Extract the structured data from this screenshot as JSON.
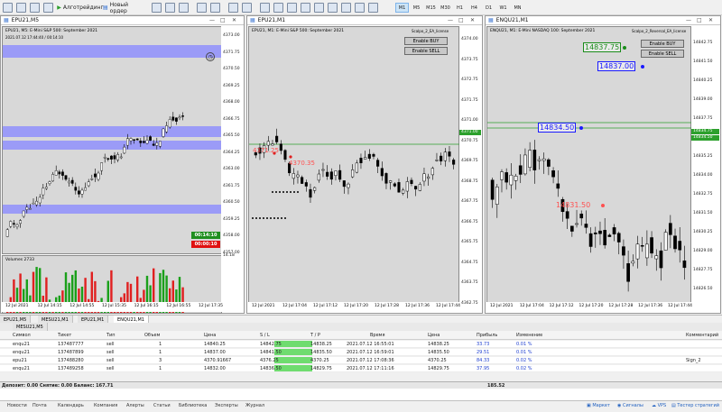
{
  "toolbar": {
    "algo_label": "Алготрейдинг",
    "new_order_label": "Новый ордер",
    "timeframes": [
      "M1",
      "M5",
      "M15",
      "M30",
      "H1",
      "H4",
      "D1",
      "W1",
      "MN"
    ],
    "active_timeframe": "M1"
  },
  "windows": [
    {
      "tab": "EPU21,M5",
      "chart_title": "EPU21, M5: E-Mini S&P 500: September 2021",
      "sub_info": "2021.07.12 17:44:40 / 00:14:10",
      "timer_green": "00:14:10",
      "timer_red": "00:00:10",
      "volume_label": "Volumes 2733",
      "prices": [
        "4373.00",
        "4371.75",
        "4370.50",
        "4369.25",
        "4368.00",
        "4366.75",
        "4365.50",
        "4364.25",
        "4363.00",
        "4361.75",
        "4360.50",
        "4359.25",
        "4358.00",
        "4357.00"
      ],
      "vol_scale": [
        "2733",
        "14.18"
      ],
      "times": [
        "12 Jul 2021",
        "12 Jul 14:15",
        "12 Jul 14:55",
        "12 Jul 15:35",
        "12 Jul 16:15",
        "12 Jul 16:55",
        "12 Jul 17:35"
      ]
    },
    {
      "tab": "EPU21,M1",
      "chart_title": "EPU21, M1: E-Mini S&P 500: September 2021",
      "ea_label": "Scalpo_2_EA_license",
      "buy_label": "Enable BUY",
      "sell_label": "Enable SELL",
      "levels": [
        "4371.25",
        "4370.35"
      ],
      "current_price": "4371.00",
      "prices": [
        "4374.00",
        "4373.75",
        "4372.75",
        "4371.75",
        "4371.00",
        "4370.75",
        "4369.75",
        "4368.75",
        "4367.75",
        "4366.75",
        "4365.75",
        "4364.75",
        "4363.75",
        "4362.75"
      ],
      "times": [
        "12 Jul 2021",
        "12 Jul 17:04",
        "12 Jul 17:12",
        "12 Jul 17:20",
        "12 Jul 17:28",
        "12 Jul 17:36",
        "12 Jul 17:44"
      ]
    },
    {
      "tab": "ENQU21,M1",
      "chart_title": "ENQU21, M1: E-Mini NASDAQ 100: September 2021",
      "ea_label": "Scalpo_2_Reversal_EA_license",
      "buy_label": "Enable BUY",
      "sell_label": "Enable SELL",
      "labels": {
        "top": "14837.75",
        "high": "14837.00",
        "mid": "14834.50",
        "low": "14831.50"
      },
      "price_tags": [
        "14834.75",
        "14834.50"
      ],
      "prices": [
        "14842.75",
        "14841.50",
        "14840.25",
        "14839.00",
        "14837.75",
        "14836.50",
        "14835.25",
        "14834.00",
        "14832.75",
        "14831.50",
        "14830.25",
        "14829.00",
        "14827.75",
        "14826.50"
      ],
      "times": [
        "12 Jul 2021",
        "12 Jul 17:04",
        "12 Jul 17:12",
        "12 Jul 17:20",
        "12 Jul 17:28",
        "12 Jul 17:36",
        "12 Jul 17:44"
      ]
    }
  ],
  "chart_tabs": [
    "EPU21,M5",
    "MESU21,M1",
    "EPU21,M1",
    "ENQU21,M1"
  ],
  "bottom_chart_tab": "MESU21,M5",
  "trade": {
    "headers": [
      "Символ",
      "Тикет",
      "Тип",
      "Объем",
      "Цена",
      "S / L",
      "T / P",
      "Время",
      "Цена",
      "Прибыль",
      "Изменение",
      "Комментарий"
    ],
    "rows": [
      [
        "enqu21",
        "137487777",
        "sell",
        "1",
        "14840.25",
        "14842.75",
        "14838.25",
        "2021.07.12 16:55:01",
        "14838.25",
        "33.73",
        "0.01 %",
        ""
      ],
      [
        "enqu21",
        "137487899",
        "sell",
        "1",
        "14837.00",
        "14841.50",
        "14835.50",
        "2021.07.12 16:59:01",
        "14835.50",
        "29.51",
        "0.01 %",
        ""
      ],
      [
        "epu21",
        "137488280",
        "sell",
        "3",
        "4370.91667",
        "4376.25",
        "4370.25",
        "2021.07.12 17:08:36",
        "4370.25",
        "84.33",
        "0.02 %",
        "Sign_2"
      ],
      [
        "enqu21",
        "137489258",
        "sell",
        "1",
        "14832.00",
        "14836.50",
        "14829.75",
        "2021.07.12 17:11:16",
        "14829.75",
        "37.95",
        "0.02 %",
        ""
      ]
    ],
    "balance_text": "Депозит: 0.00  Снятие: 0.00  Баланс: 167.71",
    "total_profit": "185.52"
  },
  "bottom_tabs": [
    "Новости",
    "Почта",
    "Календарь",
    "Компания",
    "Алерты",
    "Статьи",
    "Библиотека",
    "Эксперты",
    "Журнал"
  ],
  "bottom_right": [
    "Маркет",
    "Сигналы",
    "VPS",
    "Тестер стратегий"
  ],
  "colors": {
    "chart_bg": "#d8d8d8",
    "up": "#ffffff",
    "down": "#000000",
    "zone": "#8c8cff",
    "level": "#2ca02c",
    "sell_tp": "#7ff07f",
    "red_label": "#ff5050",
    "blue_label": "#1a1aff",
    "green_label": "#1a8c1a",
    "vol_up": "#1aa01a",
    "vol_down": "#e02020"
  }
}
